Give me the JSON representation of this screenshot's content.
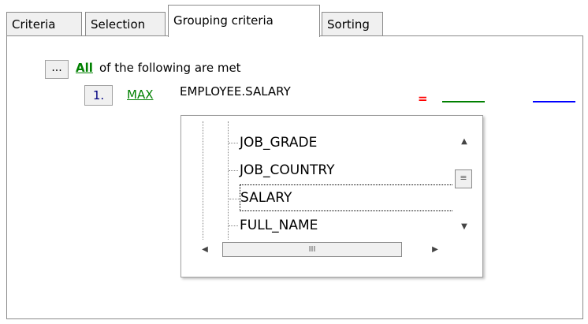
{
  "tabs": [
    {
      "label": "Criteria",
      "active": false
    },
    {
      "label": "Selection",
      "active": false
    },
    {
      "label": "Grouping criteria",
      "active": true
    },
    {
      "label": "Sorting",
      "active": false
    }
  ],
  "criteria": {
    "menu_button": "...",
    "mode_link": "All",
    "mode_suffix": "of the following are met",
    "row_number": "1.",
    "aggregate": "MAX",
    "field_value": "EMPLOYEE.SALARY",
    "operator": "="
  },
  "dropdown": {
    "items": [
      "JOB_GRADE",
      "JOB_COUNTRY",
      "SALARY",
      "FULL_NAME"
    ],
    "selected": "SALARY",
    "vthumb_glyph": "≡",
    "hthumb_glyph": "III",
    "up_arrow": "▲",
    "down_arrow": "▼",
    "left_arrow": "◀",
    "right_arrow": "▶"
  },
  "colors": {
    "link_green": "#008000",
    "operator_red": "#ff0000",
    "value_blue": "#0000ff"
  }
}
